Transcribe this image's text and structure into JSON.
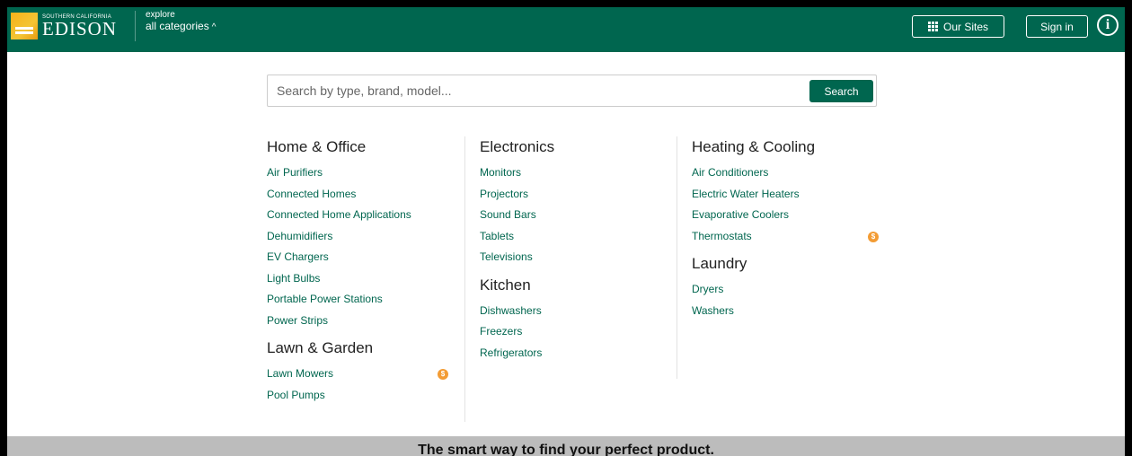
{
  "header": {
    "logo_small": "Southern California",
    "logo_big": "EDISON",
    "explore_small": "explore",
    "explore_big": "all categories",
    "explore_caret": "^",
    "our_sites_label": "Our Sites",
    "sign_in_label": "Sign in",
    "info_glyph": "i"
  },
  "search": {
    "placeholder": "Search by type, brand, model...",
    "value": "",
    "button_label": "Search"
  },
  "categories": {
    "col1": [
      {
        "heading": "Home & Office",
        "items": [
          {
            "label": "Air Purifiers",
            "rebate": false
          },
          {
            "label": "Connected Homes",
            "rebate": false
          },
          {
            "label": "Connected Home Applications",
            "rebate": false
          },
          {
            "label": "Dehumidifiers",
            "rebate": false
          },
          {
            "label": "EV Chargers",
            "rebate": false
          },
          {
            "label": "Light Bulbs",
            "rebate": false
          },
          {
            "label": "Portable Power Stations",
            "rebate": false
          },
          {
            "label": "Power Strips",
            "rebate": false
          }
        ]
      },
      {
        "heading": "Lawn & Garden",
        "items": [
          {
            "label": "Lawn Mowers",
            "rebate": true
          },
          {
            "label": "Pool Pumps",
            "rebate": false
          }
        ]
      }
    ],
    "col2": [
      {
        "heading": "Electronics",
        "items": [
          {
            "label": "Monitors",
            "rebate": false
          },
          {
            "label": "Projectors",
            "rebate": false
          },
          {
            "label": "Sound Bars",
            "rebate": false
          },
          {
            "label": "Tablets",
            "rebate": false
          },
          {
            "label": "Televisions",
            "rebate": false
          }
        ]
      },
      {
        "heading": "Kitchen",
        "items": [
          {
            "label": "Dishwashers",
            "rebate": false
          },
          {
            "label": "Freezers",
            "rebate": false
          },
          {
            "label": "Refrigerators",
            "rebate": false
          }
        ]
      }
    ],
    "col3": [
      {
        "heading": "Heating & Cooling",
        "items": [
          {
            "label": "Air Conditioners",
            "rebate": false
          },
          {
            "label": "Electric Water Heaters",
            "rebate": false
          },
          {
            "label": "Evaporative Coolers",
            "rebate": false
          },
          {
            "label": "Thermostats",
            "rebate": true
          }
        ]
      },
      {
        "heading": "Laundry",
        "items": [
          {
            "label": "Dryers",
            "rebate": false
          },
          {
            "label": "Washers",
            "rebate": false
          }
        ]
      }
    ],
    "rebate_glyph": "$",
    "rebate_icon": "dollar-rebate-icon",
    "rebate_color": "#f39c34"
  },
  "footer": {
    "tagline": "The smart way to find your perfect product."
  },
  "colors": {
    "brand_green": "#00664f",
    "footer_gray": "#bcbcbc"
  }
}
